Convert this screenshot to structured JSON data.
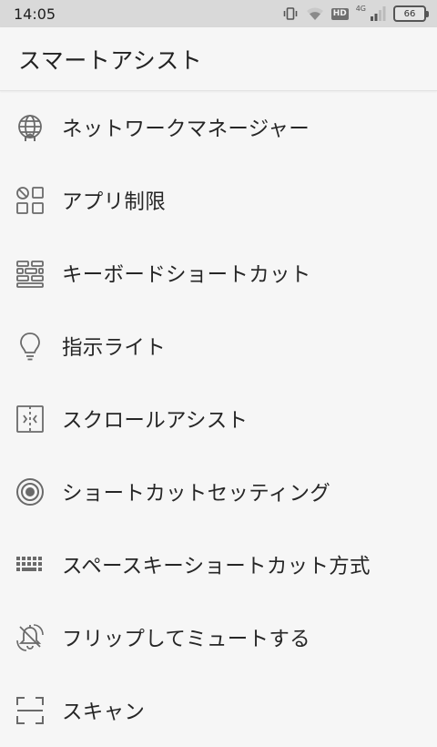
{
  "status_bar": {
    "time": "14:05",
    "hd": "HD",
    "network": "4G",
    "battery": "66",
    "icons": [
      "vibrate-icon",
      "wifi-icon",
      "hd-icon",
      "signal-icon",
      "battery-icon"
    ]
  },
  "header": {
    "title": "スマートアシスト"
  },
  "menu": {
    "items": [
      {
        "label": "ネットワークマネージャー",
        "icon": "globe-network-icon"
      },
      {
        "label": "アプリ制限",
        "icon": "app-grid-icon"
      },
      {
        "label": "キーボードショートカット",
        "icon": "keyboard-bricks-icon"
      },
      {
        "label": "指示ライト",
        "icon": "lightbulb-icon"
      },
      {
        "label": "スクロールアシスト",
        "icon": "scroll-assist-icon"
      },
      {
        "label": "ショートカットセッティング",
        "icon": "target-icon"
      },
      {
        "label": "スペースキーショートカット方式",
        "icon": "keyboard-icon"
      },
      {
        "label": "フリップしてミュートする",
        "icon": "flip-mute-icon"
      },
      {
        "label": "スキャン",
        "icon": "scan-icon"
      }
    ]
  },
  "colors": {
    "status_bar_bg": "#d9d9d9",
    "page_bg": "#f6f6f6",
    "icon_gray": "#6a6a6a",
    "text": "#262626"
  }
}
